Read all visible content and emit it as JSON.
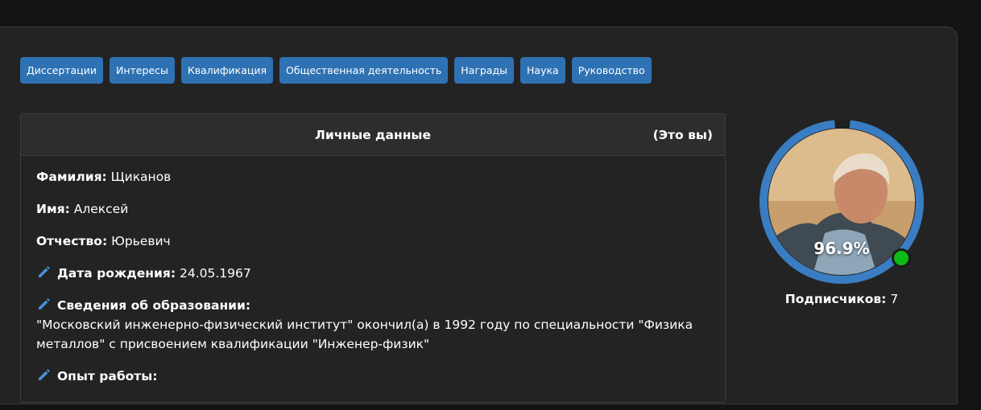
{
  "tabs": [
    {
      "label": "Диссертации"
    },
    {
      "label": "Интересы"
    },
    {
      "label": "Квалификация"
    },
    {
      "label": "Общественная деятельность"
    },
    {
      "label": "Награды"
    },
    {
      "label": "Наука"
    },
    {
      "label": "Руководство"
    }
  ],
  "card": {
    "title": "Личные данные",
    "you_label": "(Это вы)",
    "fields": {
      "surname": {
        "label": "Фамилия:",
        "value": "Щиканов"
      },
      "name": {
        "label": "Имя:",
        "value": "Алексей"
      },
      "patronymic": {
        "label": "Отчество:",
        "value": "Юрьевич"
      },
      "birthdate": {
        "label": "Дата рождения:",
        "value": "24.05.1967",
        "icon": "pencil-icon"
      },
      "education": {
        "label": "Сведения об образовании:",
        "value": "\"Московский инженерно-физический институт\" окончил(а) в 1992 году по специальности \"Физика металлов\" с присвоением квалификации \"Инженер-физик\"",
        "icon": "pencil-icon"
      },
      "experience": {
        "label": "Опыт работы:",
        "icon": "pencil-icon"
      }
    }
  },
  "profile": {
    "completion_text": "96.9%",
    "completion_fraction": 0.969,
    "status": "online",
    "subscribers_label": "Подписчиков:",
    "subscribers_value": "7"
  },
  "colors": {
    "accent": "#2f72b3",
    "ring": "#3a7dc2",
    "online": "#0dbb16",
    "pencil": "#4a90d9"
  }
}
